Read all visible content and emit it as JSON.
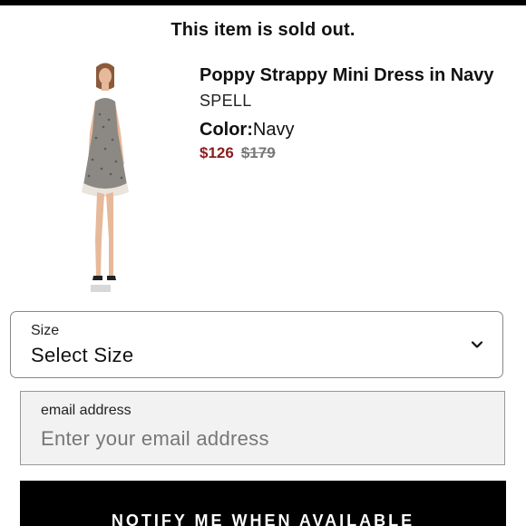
{
  "banner": {
    "sold_out": "This item is sold out."
  },
  "product": {
    "title": "Poppy Strappy Mini Dress in Navy",
    "brand": "SPELL",
    "color_label": "Color:",
    "color_value": "Navy",
    "price_sale": "$126",
    "price_original": "$179",
    "image_icon": "product-photo-dress"
  },
  "size_select": {
    "label": "Size",
    "value": "Select Size",
    "icon": "chevron-down-icon"
  },
  "email": {
    "label": "email address",
    "placeholder": "Enter your email address"
  },
  "notify_button": {
    "label": "NOTIFY ME WHEN AVAILABLE"
  },
  "colors": {
    "sale_price": "#8b1e1e",
    "button_bg": "#000000",
    "email_bg": "#f2f2f2"
  }
}
